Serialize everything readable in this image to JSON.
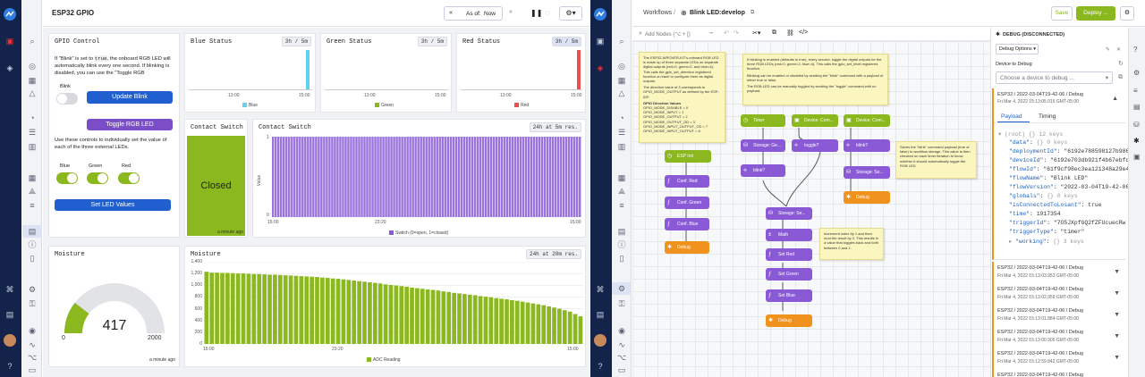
{
  "left_app": {
    "dashboard_title": "ESP32 GPIO",
    "toolbar": {
      "as_of_label": "As of:",
      "as_of_value": "Now"
    },
    "gpio_control": {
      "title": "GPIO Control",
      "desc1_a": "If \"Blink\" is set to",
      "desc1_code": "true",
      "desc1_b": ", the onboard RGB LED will automatically blink every one second. If blinking is disabled, you can use the \"Toggle RGB",
      "blink_label": "Blink",
      "update_blink": "Update Blink",
      "toggle_rgb": "Toggle RGB LED",
      "desc2": "Use these controls to individually set the value of each of the three external LEDs.",
      "blue_label": "Blue",
      "green_label": "Green",
      "red_label": "Red",
      "set_led": "Set LED Values"
    },
    "blue_status": {
      "title": "Blue Status",
      "range": "3h / 5m",
      "x1": "13:00",
      "x2": "15:00",
      "legend": "Blue"
    },
    "green_status": {
      "title": "Green Status",
      "range": "3h / 5m",
      "x1": "13:00",
      "x2": "15:00",
      "legend": "Green"
    },
    "red_status": {
      "title": "Red Status",
      "range": "3h / 5m",
      "x1": "13:00",
      "x2": "15:00",
      "legend": "Red"
    },
    "contact_switch_indicator": {
      "title": "Contact Switch",
      "value": "Closed",
      "time": "a minute ago"
    },
    "contact_switch_chart": {
      "title": "Contact Switch",
      "range": "24h at 5m res.",
      "ylabel": "Value",
      "y1": "1",
      "y0": "0",
      "x1": "15:00",
      "x2": "23:20",
      "x3": "15:00",
      "legend": "Switch (0=open, 1=closed)"
    },
    "moisture_gauge": {
      "title": "Moisture",
      "value": "417",
      "min": "0",
      "max": "2000",
      "time": "a minute ago"
    },
    "moisture_chart": {
      "title": "Moisture",
      "range": "24h at 20m res.",
      "y": [
        "1,400",
        "1,200",
        "1,000",
        "800",
        "600",
        "400",
        "200",
        "0"
      ],
      "x1": "15:00",
      "x2": "23:20",
      "x3": "15:00",
      "legend": "ADC Reading"
    }
  },
  "right_app": {
    "breadcrumb_root": "Workflows",
    "breadcrumb_flow": "Blink LED:develop",
    "save": "Save",
    "deploy": "Deploy ...",
    "add_nodes_placeholder": "Add Nodes (⌥ + [)",
    "debug": {
      "header": "DEBUG (DISCONNECTED)",
      "options": "Debug Options",
      "device_label": "Device to Debug",
      "device_placeholder": "Choose a device to debug ...",
      "open_title": "ESP32 / 2022-03-04T19-42-06 / Debug",
      "open_time": "Fri Mar 4, 2022 15:13:05.015 GMT-05:00",
      "tab_payload": "Payload",
      "tab_timing": "Timing",
      "json_root": "(root)",
      "json_root_count": "{} 12 keys",
      "json": [
        {
          "k": "\"data\"",
          "v": "{} 0 keys",
          "meta": true
        },
        {
          "k": "\"deploymentId\"",
          "v": "\"6192e788598127b986"
        },
        {
          "k": "\"deviceId\"",
          "v": "\"6192e703db921f4b67ebfd"
        },
        {
          "k": "\"flowId\"",
          "v": "\"61f9cf98ec3ea121348a29e4"
        },
        {
          "k": "\"flowName\"",
          "v": "\"Blink LED\""
        },
        {
          "k": "\"flowVersion\"",
          "v": "\"2022-03-04T19-42-06"
        },
        {
          "k": "\"globals\"",
          "v": "{} 0 keys",
          "meta": true
        },
        {
          "k": "\"isConnectedToLosant\"",
          "v": "true"
        },
        {
          "k": "\"time\"",
          "v": "1917354"
        },
        {
          "k": "\"triggerId\"",
          "v": "\"7O5JXpfGQ2fZFUcuecRw"
        },
        {
          "k": "\"triggerType\"",
          "v": "\"timer\""
        },
        {
          "k": "\"working\"",
          "v": "{} 3 keys",
          "meta": true
        }
      ],
      "rows": [
        {
          "title": "ESP32 / 2022-03-04T19-42-06 / Debug",
          "time": "Fri Mar 4, 2022 15:13:03.953 GMT-05:00"
        },
        {
          "title": "ESP32 / 2022-03-04T19-42-06 / Debug",
          "time": "Fri Mar 4, 2022 15:13:02.959 GMT-05:00"
        },
        {
          "title": "ESP32 / 2022-03-04T19-42-06 / Debug",
          "time": "Fri Mar 4, 2022 15:13:01.884 GMT-05:00"
        },
        {
          "title": "ESP32 / 2022-03-04T19-42-06 / Debug",
          "time": "Fri Mar 4, 2022 15:13:00.905 GMT-05:00"
        },
        {
          "title": "ESP32 / 2022-03-04T19-42-06 / Debug",
          "time": "Fri Mar 4, 2022 15:12:59.842 GMT-05:00"
        },
        {
          "title": "ESP32 / 2022-03-04T19-42-06 / Debug",
          "time": ""
        }
      ]
    },
    "nodes": {
      "esp_init": "ESP Init",
      "conf_red": "Conf. Red",
      "conf_green": "Conf. Green",
      "conf_blue": "Conf. Blue",
      "debug1": "Debug",
      "timer": "Timer",
      "device_cmd1": "Device: Com...",
      "device_cmd2": "Device: Com...",
      "storage_get": "Storage: Ge...",
      "toggle": "toggle?",
      "blink1": "blink?",
      "blink2": "blink?",
      "storage_set1": "Storage: Se...",
      "debug2": "Debug",
      "storage_set2": "Storage: Se...",
      "math": "Math",
      "set_red": "Set Red",
      "set_green": "Set Green",
      "set_blue": "Set Blue",
      "debug3": "Debug"
    },
    "notes": {
      "note1": "The ESP32-WROVER-KIT's onboard RGB LED is made up of three separate LEDs on separate digital outputs (red=0, green=2, and blue=4). This calls the gpio_set_direction registered function on each to configure them as digital outputs.",
      "note1b": "The direction value of 3 corresponds to GPIO_MODE_OUTPUT as defined by the ESP-IDF.",
      "note1c": "GPIO Direction Values",
      "note1d": "GPIO_MODE_DISABLE = 0\nGPIO_MODE_INPUT = 1\nGPIO_MODE_OUTPUT = 2\nGPIO_MODE_OUTPUT_OD = 3\nGPIO_MODE_INPUT_OUTPUT_OD = 7\nGPIO_MODE_INPUT_OUTPUT = 6",
      "note2": "If blinking is enabled (defaults to true), every second, toggle the digital outputs for the three RGB LEDs (red=0, green=2, blue=4). This calls the gpio_set_level registered function.",
      "note2b": "Blinking can be enabled or disabled by sending the \"blink\" command with a payload of either true or false.",
      "note2c": "The RGB LED can be manually toggled by sending the \"toggle\" command with no payload.",
      "note3": "Saves the \"blink\" command payload (true or false) to workflow storage. This value is then checked on each timer iteration to know whether it should automatically toggle the RGB LED.",
      "note4": "Increment index by 1 and then mod the result by 2. This results in a value that toggles back and forth between 0 and 1."
    }
  },
  "colors": {
    "rail": "#13234a",
    "blue_btn": "#1f5fcf",
    "purple_btn": "#7b4ec8",
    "green": "#8ab81e",
    "orange": "#f0921e",
    "node_purple": "#8a5ad6",
    "node_green": "#8ab81e",
    "deploy": "#8ab81e"
  },
  "chart_data": [
    {
      "type": "bar",
      "title": "Blue Status",
      "series": [
        {
          "name": "Blue"
        }
      ],
      "x_ticks": [
        "13:00",
        "15:00"
      ],
      "note": "value shown as single bar at right edge"
    },
    {
      "type": "bar",
      "title": "Green Status",
      "series": [
        {
          "name": "Green"
        }
      ],
      "x_ticks": [
        "13:00",
        "15:00"
      ]
    },
    {
      "type": "bar",
      "title": "Red Status",
      "series": [
        {
          "name": "Red"
        }
      ],
      "x_ticks": [
        "13:00",
        "15:00"
      ]
    },
    {
      "type": "bar",
      "title": "Contact Switch",
      "ylabel": "Value",
      "ylim": [
        0,
        1
      ],
      "x_ticks": [
        "15:00",
        "23:20",
        "15:00"
      ],
      "series": [
        {
          "name": "Switch (0=open, 1=closed)",
          "value": 1
        }
      ]
    },
    {
      "type": "bar",
      "title": "Moisture",
      "ylim": [
        0,
        1400
      ],
      "x_ticks": [
        "15:00",
        "23:20",
        "15:00"
      ],
      "series": [
        {
          "name": "ADC Reading",
          "values": [
            1230,
            1215,
            1215,
            1210,
            1210,
            1205,
            1200,
            1200,
            1195,
            1190,
            1190,
            1185,
            1180,
            1180,
            1175,
            1170,
            1165,
            1160,
            1155,
            1150,
            1145,
            1140,
            1130,
            1125,
            1115,
            1110,
            1100,
            1090,
            1080,
            1070,
            1060,
            1050,
            1040,
            1030,
            1015,
            1005,
            995,
            985,
            975,
            960,
            950,
            940,
            930,
            920,
            910,
            895,
            885,
            870,
            860,
            850,
            840,
            830,
            815,
            805,
            795,
            780,
            770,
            760,
            745,
            735,
            720,
            705,
            690,
            675,
            660,
            640,
            620,
            600,
            575,
            550,
            510,
            470
          ]
        }
      ]
    }
  ]
}
